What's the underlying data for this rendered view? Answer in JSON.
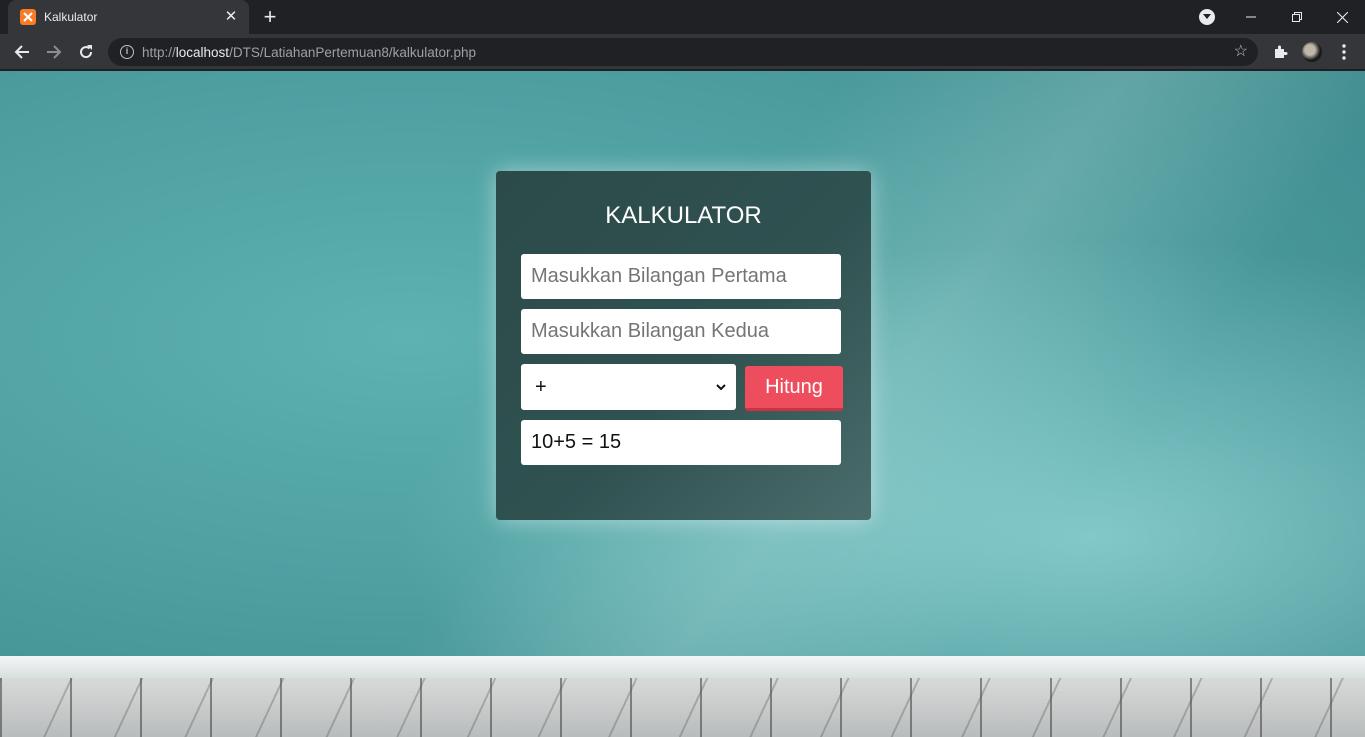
{
  "browser": {
    "tab_title": "Kalkulator",
    "tab_close": "✕",
    "new_tab": "+",
    "url_scheme": "http://",
    "url_host": "localhost",
    "url_path": "/DTS/LatiahanPertemuan8/kalkulator.php",
    "icons": [
      "xampp-favicon",
      "close-icon",
      "plus-icon",
      "profile-menu-icon",
      "minimize-icon",
      "restore-icon",
      "window-close-icon",
      "back-icon",
      "forward-icon",
      "reload-icon",
      "info-icon",
      "star-icon",
      "extensions-icon",
      "avatar",
      "menu-icon"
    ]
  },
  "calculator": {
    "title": "KALKULATOR",
    "first_placeholder": "Masukkan Bilangan Pertama",
    "second_placeholder": "Masukkan Bilangan Kedua",
    "operator": "+",
    "submit_label": "Hitung",
    "result": "10+5 = 15",
    "colors": {
      "card": "#2f5251",
      "button": "#ee4d5d",
      "background": "#5eb2b1"
    }
  }
}
